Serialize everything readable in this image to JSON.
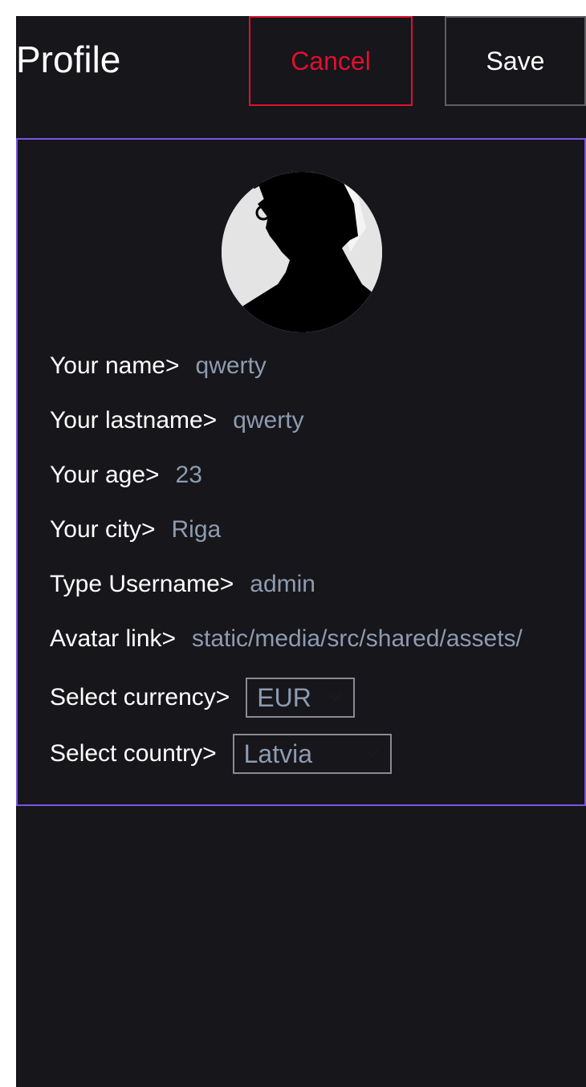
{
  "header": {
    "title": "Profile",
    "cancel_label": "Cancel",
    "save_label": "Save"
  },
  "profile": {
    "fields": [
      {
        "label": "Your name>",
        "value": "qwerty"
      },
      {
        "label": "Your lastname>",
        "value": "qwerty"
      },
      {
        "label": "Your age>",
        "value": "23"
      },
      {
        "label": "Your city>",
        "value": "Riga"
      },
      {
        "label": "Type Username>",
        "value": "admin"
      },
      {
        "label": "Avatar link>",
        "value": "static/media/src/shared/assets/"
      }
    ],
    "currency": {
      "label": "Select currency>",
      "selected": "EUR"
    },
    "country": {
      "label": "Select country>",
      "selected": "Latvia"
    }
  },
  "colors": {
    "background": "#16161b",
    "accent_border": "#7c55e6",
    "cancel": "#e0102e",
    "value_text": "#8e9bb0"
  },
  "icons": {
    "avatar": "avatar-icon",
    "dropdown": "chevron-down-icon"
  }
}
